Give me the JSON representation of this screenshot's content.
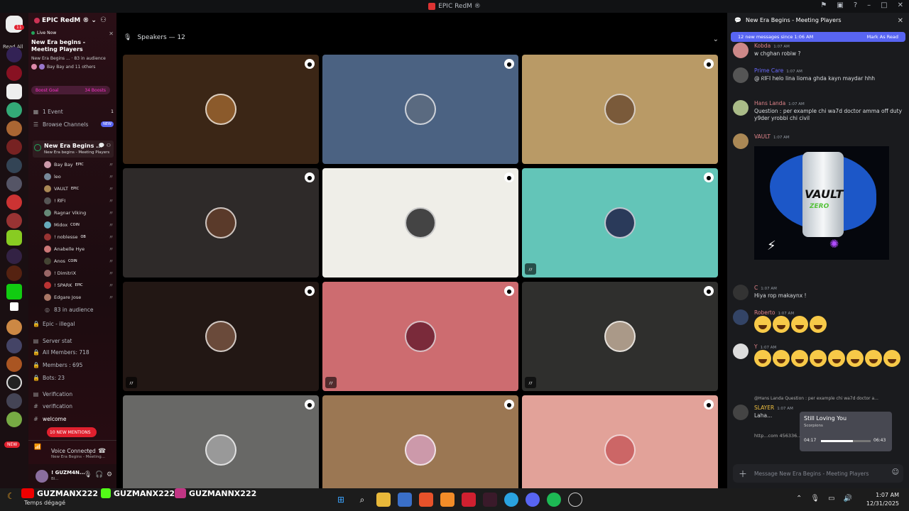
{
  "window": {
    "title": "EPIC RedM ®"
  },
  "rail": {
    "read_all": "Read All",
    "dm_badge": "11",
    "new_label": "NEW",
    "badges": [
      "1",
      "5",
      "47",
      "9",
      "3",
      "10",
      "10",
      "1",
      "1",
      "1",
      "1"
    ]
  },
  "guild": {
    "name": "EPIC RedM ®"
  },
  "live": {
    "tag": "Live Now",
    "title": "New Era begins - Meeting Players",
    "meta": "New Era Begins ... · 83 in audience",
    "people": "Bay Bay and 11 others"
  },
  "boost": {
    "goal": "Boost Goal",
    "count": "34 Boosts"
  },
  "channels": {
    "events": "1 Event",
    "events_count": "1",
    "browse": "Browse Channels",
    "browse_badge": "NEW"
  },
  "stage_channel": {
    "name": "New Era Begins ...",
    "topic": "New Era begins - Meeting Players"
  },
  "members": [
    {
      "name": "Bay Bay",
      "tag": "EPIC",
      "color": "#c9a"
    },
    {
      "name": "leo",
      "tag": "",
      "color": "#789"
    },
    {
      "name": "VAULT",
      "tag": "EPIC",
      "color": "#a85"
    },
    {
      "name": "! ᖇIᖴI",
      "tag": "",
      "color": "#555"
    },
    {
      "name": "Ragnar Viking",
      "tag": "",
      "color": "#687"
    },
    {
      "name": "Midox",
      "tag": "COIN",
      "color": "#6ab"
    },
    {
      "name": "! noblesse",
      "tag": "OB",
      "color": "#933"
    },
    {
      "name": "Anabelle Hye",
      "tag": "",
      "color": "#c77"
    },
    {
      "name": "Anos",
      "tag": "COIN",
      "color": "#443"
    },
    {
      "name": "! DimitriX",
      "tag": "",
      "color": "#966"
    },
    {
      "name": "! SPARK",
      "tag": "EPIC",
      "color": "#b33"
    },
    {
      "name": "Edgare Jose",
      "tag": "",
      "color": "#a76"
    }
  ],
  "audience": "83 in audience",
  "lower_channels": {
    "illegal": "Epic - illegal",
    "server_stat": "Server stat",
    "all_members": "All Members: 718",
    "members": "Members : 695",
    "bots": "Bots: 23",
    "verification_cat": "Verification",
    "verification": "verification",
    "welcome": "welcome",
    "mentions": "10 NEW MENTIONS"
  },
  "voice": {
    "status": "Voice Connected",
    "channel": "New Era Begins - Meeting..."
  },
  "user": {
    "name": "! GUZM4N...",
    "status": "Bl..."
  },
  "stage": {
    "speakers_label": "Speakers — 12",
    "tiles": [
      {
        "bg": "#3b2616",
        "muted": false,
        "av": "#8b5a2b"
      },
      {
        "bg": "#4b6282",
        "muted": false,
        "av": "#5a6a80"
      },
      {
        "bg": "#b99a66",
        "muted": false,
        "av": "#7a5a3a"
      },
      {
        "bg": "#2e2a29",
        "muted": false,
        "av": "#5a3a2a"
      },
      {
        "bg": "#efeee8",
        "muted": false,
        "av": "#444"
      },
      {
        "bg": "#63c5b8",
        "muted": true,
        "av": "#2a3a5a"
      },
      {
        "bg": "#221714",
        "muted": true,
        "av": "#6a4a3a"
      },
      {
        "bg": "#cd6c70",
        "muted": true,
        "av": "#7a2a3a"
      },
      {
        "bg": "#2f2f2d",
        "muted": true,
        "av": "#a98"
      },
      {
        "bg": "#686866",
        "muted": false,
        "av": "#999"
      },
      {
        "bg": "#9b7753",
        "muted": false,
        "av": "#c9a"
      },
      {
        "bg": "#e2a299",
        "muted": false,
        "av": "#c66"
      }
    ]
  },
  "chat": {
    "title": "New Era Begins - Meeting Players",
    "new_messages": "12 new messages since 1:06 AM",
    "mark_read": "Mark As Read",
    "messages": [
      {
        "name": "Kobda",
        "color": "#e0848a",
        "time": "1:07 AM",
        "text": "w chghan robiw ?",
        "av": "#c88"
      },
      {
        "name": "Prime Care",
        "color": "#6a6aff",
        "time": "1:07 AM",
        "text": "@ ᖇIᖴI  helo lina lioma ghda kayn maydar hhh",
        "av": "#555"
      },
      {
        "name": "Hans Landa",
        "color": "#e0848a",
        "time": "1:07 AM",
        "text": "Question : per example chi wa7d doctor amma off duty y9der yrobbi chi civil",
        "av": "#ab8"
      },
      {
        "name": "VAULT",
        "color": "#e0848a",
        "time": "1:07 AM",
        "text": "",
        "av": "#a85"
      },
      {
        "name": "C",
        "color": "#e0848a",
        "time": "1:07 AM",
        "text": "Hiya rop makaynx !",
        "av": "#333"
      },
      {
        "name": "Roberto",
        "color": "#e0848a",
        "time": "1:07 AM",
        "text": "",
        "av": "#346"
      },
      {
        "name": "Y",
        "color": "#e0848a",
        "time": "1:07 AM",
        "text": "",
        "av": "#ddd"
      },
      {
        "name": "SLAYER",
        "color": "#f0c040",
        "time": "1:07 AM",
        "text": "Laha...",
        "av": "#444"
      }
    ],
    "reply_preview": "@Hans Landa  Question : per example chi wa7d doctor a...",
    "link_text": "http...com 456336...",
    "composer_placeholder": "Message New Era Begins - Meeting Players"
  },
  "vault_image": {
    "brand": "VAULT",
    "sub": "ZERO"
  },
  "music": {
    "title": "Still Loving You",
    "artist": "Scorpions",
    "elapsed": "04:17",
    "total": "06:43",
    "progress": 0.64
  },
  "taskbar": {
    "weather": "Temps dégagé",
    "youtube": "GUZMANX222",
    "kick": "GUZMANX222",
    "instagram": "GUZMANNX222",
    "time": "1:07 AM",
    "date": "12/31/2025"
  }
}
